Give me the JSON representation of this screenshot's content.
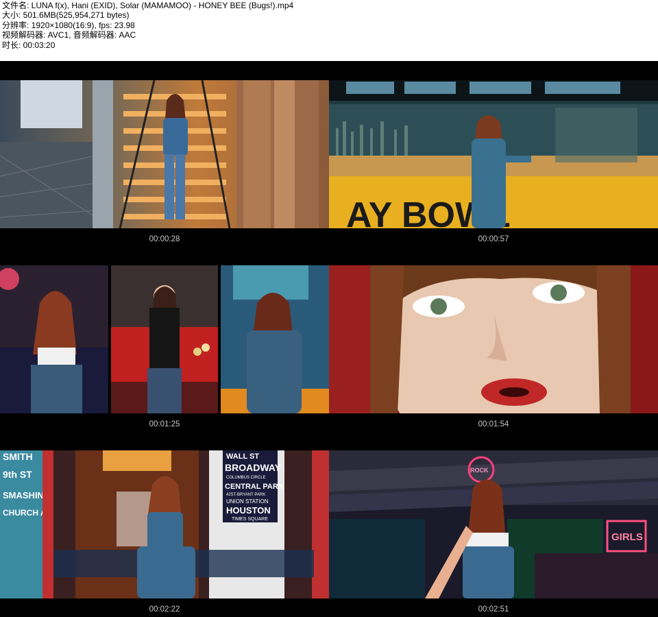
{
  "file_info": {
    "filename": "文件名: LUNA f(x), Hani (EXID), Solar (MAMAMOO) - HONEY BEE (Bugs!).mp4",
    "size": "大小: 501.6MB(525,954,271 bytes)",
    "resolution": "分辨率: 1920×1080(16:9), fps: 23.98",
    "codecs": "视频解码器: AVC1, 音频解码器: AAC",
    "duration": "时长: 00:03:20"
  },
  "thumbnails": [
    {
      "timestamp": "00:00:28"
    },
    {
      "timestamp": "00:00:57"
    },
    {
      "timestamp": "00:01:25"
    },
    {
      "timestamp": "00:01:54"
    },
    {
      "timestamp": "00:02:22"
    },
    {
      "timestamp": "00:02:51"
    }
  ],
  "signs": {
    "bar_sign": "AY BOWL",
    "broadway": [
      "WALL ST",
      "BROADWAY",
      "COLUMBUS CIRCLE",
      "CENTRAL PARK",
      "42ST-BRYANT PARK",
      "UNION STATION",
      "HOUSTON",
      "TIMES SQUARE"
    ],
    "wall_text": [
      "SMITH",
      "9th ST",
      "SMASHIN",
      "CHURCH AV"
    ],
    "neon_girls": "GIRLS",
    "neon_rock": "ROCK"
  }
}
